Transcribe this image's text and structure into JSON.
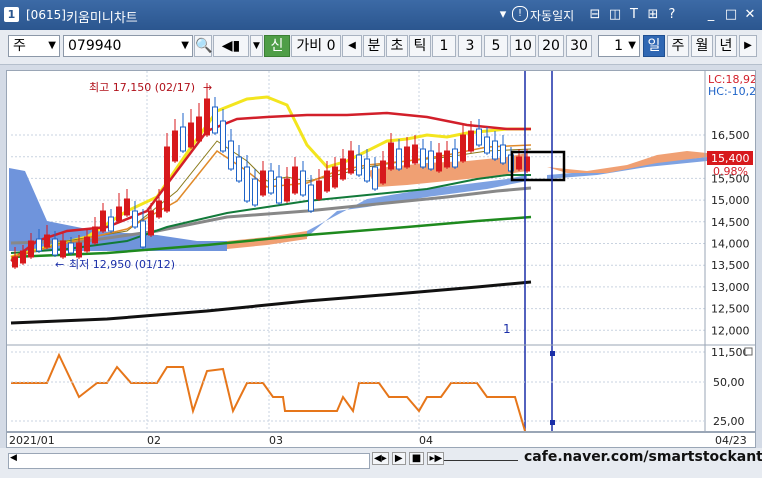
{
  "window": {
    "number": "1",
    "code": "[0615]",
    "title": "키움미니차트",
    "help_label": "자동일지"
  },
  "toolbar": {
    "period_type": "주",
    "stock_code": "079940",
    "new_label": "신",
    "price_label": "가비",
    "price_value": "0",
    "unit_min": "분",
    "unit_sec": "초",
    "unit_tick": "틱",
    "intervals": [
      "1",
      "3",
      "5",
      "10",
      "20",
      "30"
    ],
    "count_value": "1",
    "day": "일",
    "week": "주",
    "month": "월",
    "year": "년"
  },
  "chart": {
    "high_label": "최고 17,150 (02/17)",
    "low_label": "최저 12,950 (01/12)",
    "lc_label": "LC:18,92",
    "hc_label": "HC:-10,2",
    "price_ticks": [
      "16,500",
      "16,000",
      "15,500",
      "15,000",
      "14,500",
      "14,000",
      "13,500",
      "13,000",
      "12,500",
      "12,000",
      "11,500"
    ],
    "current_price": "15,400",
    "current_change": "0.98%",
    "marker_label": "1",
    "osc_ticks": [
      "50,00",
      "25,00"
    ],
    "dates": [
      "2021/01",
      "02",
      "03",
      "04",
      "04/23"
    ]
  },
  "chart_data": {
    "type": "candlestick",
    "ylim": [
      11500,
      16800
    ],
    "overlays": [
      "moving averages",
      "ichimoku cloud"
    ],
    "oscillator_ylim": [
      20,
      75
    ]
  },
  "watermark": "cafe.naver.com/smartstockant",
  "colors": {
    "title_bg": "#2b568f",
    "selected": "#2f67b3",
    "up": "#d7191c",
    "down": "#1e63c8"
  }
}
